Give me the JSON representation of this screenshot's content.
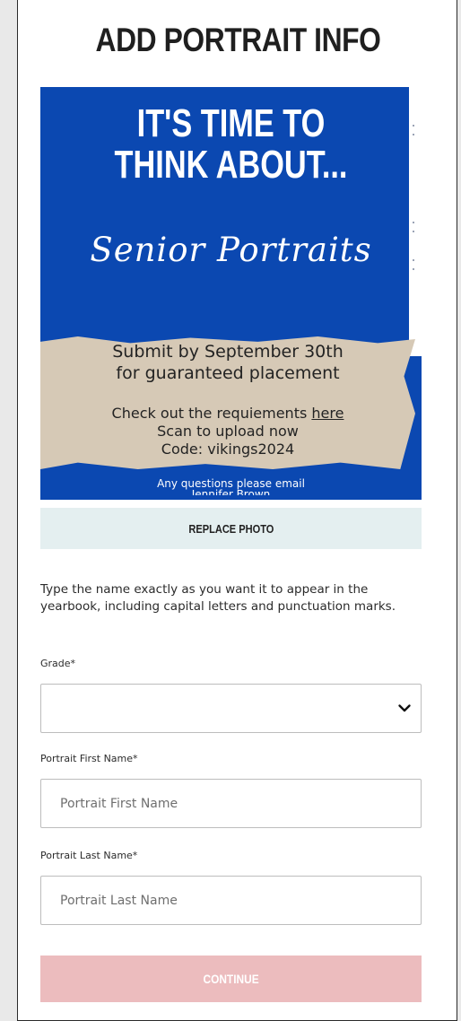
{
  "page": {
    "title": "ADD PORTRAIT INFO"
  },
  "flyer": {
    "headline_line1": "IT'S TIME TO",
    "headline_line2": "THINK ABOUT...",
    "script_text": "Senior Portraits",
    "submit_line1": "Submit by September 30th",
    "submit_line2": "for guaranteed placement",
    "requirements_prefix": "Check out the requiements ",
    "requirements_link": "here",
    "scan_line": "Scan to upload now",
    "code_line": "Code: vikings2024",
    "footer_line1": "Any questions please email",
    "footer_line2": "Jennifer Brown",
    "colors": {
      "background": "#0b48b1",
      "paper": "#d6c9b6"
    }
  },
  "actions": {
    "replace_photo_label": "REPLACE PHOTO",
    "continue_label": "CONTINUE"
  },
  "form": {
    "hint": "Type the name exactly as you want it to appear in the yearbook, including capital letters and punctuation marks.",
    "grade": {
      "label": "Grade*",
      "selected": "",
      "icon": "chevron-down-icon"
    },
    "first_name": {
      "label": "Portrait First Name*",
      "value": "",
      "placeholder": "Portrait First Name"
    },
    "last_name": {
      "label": "Portrait Last Name*",
      "value": "",
      "placeholder": "Portrait Last Name"
    }
  },
  "colors": {
    "continue_disabled": "#ecbcbe",
    "replace_bg": "#e4eff0"
  }
}
